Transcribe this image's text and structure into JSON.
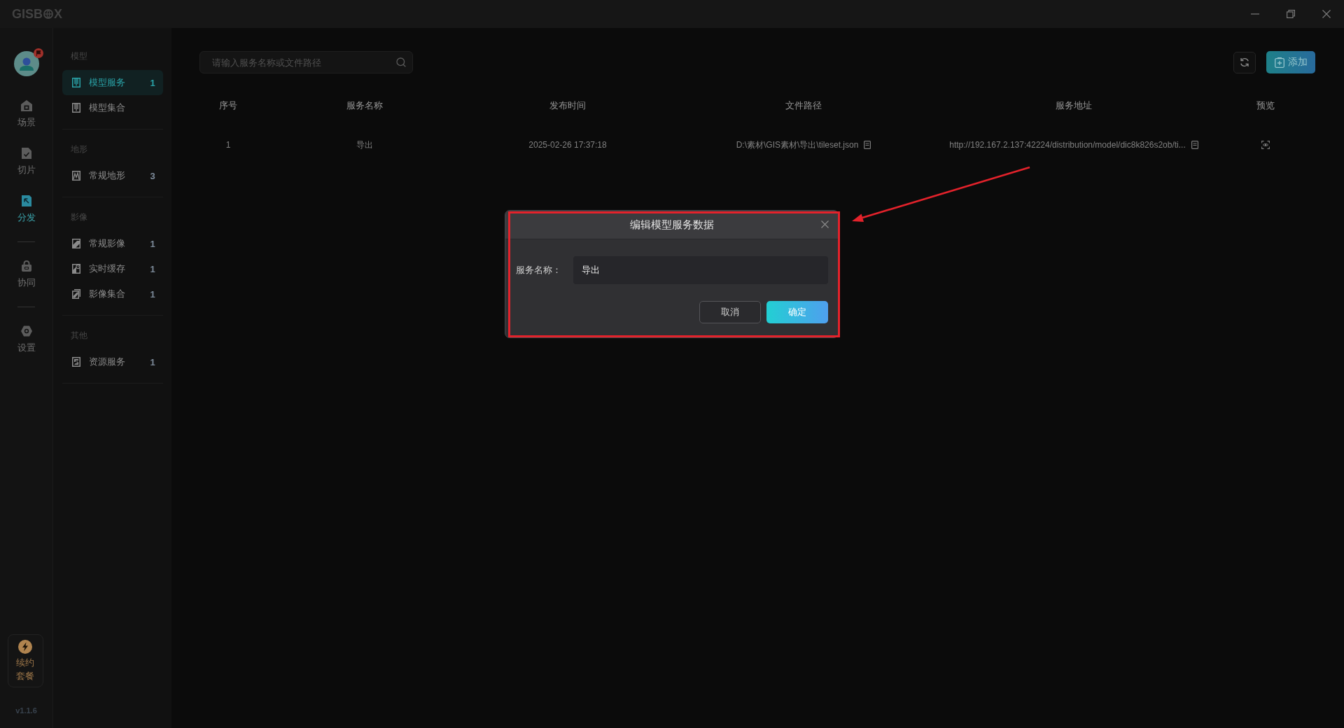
{
  "titlebar": {
    "logo_start": "GISB",
    "logo_end": "X"
  },
  "rail": {
    "groups": [
      {
        "items": [
          {
            "label": "场景",
            "selected": false
          },
          {
            "label": "切片",
            "selected": false
          },
          {
            "label": "分发",
            "selected": true
          }
        ]
      },
      {
        "items": [
          {
            "label": "协同",
            "selected": false
          }
        ]
      },
      {
        "items": [
          {
            "label": "设置",
            "selected": false
          }
        ]
      }
    ],
    "renewal": {
      "label": "续约套餐"
    },
    "version": "v1.1.6"
  },
  "sidebar": {
    "sections": [
      {
        "title": "模型",
        "items": [
          {
            "label": "模型服务",
            "count": "1",
            "selected": true
          },
          {
            "label": "模型集合",
            "selected": false
          }
        ]
      },
      {
        "title": "地形",
        "items": [
          {
            "label": "常规地形",
            "count": "3",
            "selected": false
          }
        ]
      },
      {
        "title": "影像",
        "items": [
          {
            "label": "常规影像",
            "count": "1",
            "selected": false
          },
          {
            "label": "实时缓存",
            "count": "1",
            "selected": false
          },
          {
            "label": "影像集合",
            "count": "1",
            "selected": false
          }
        ]
      },
      {
        "title": "其他",
        "items": [
          {
            "label": "资源服务",
            "count": "1",
            "selected": false
          }
        ]
      }
    ]
  },
  "toolbar": {
    "search": {
      "placeholder": "请输入服务名称或文件路径"
    },
    "add_button": {
      "label": "添加"
    }
  },
  "table": {
    "columns": [
      "序号",
      "服务名称",
      "发布时间",
      "文件路径",
      "服务地址",
      "预览"
    ],
    "rows": [
      {
        "index": "1",
        "name": "导出",
        "published": "2025-02-26 17:37:18",
        "file_path": "D:\\素材\\GIS素材\\导出\\tileset.json",
        "service_url": "http://192.167.2.137:42224/distribution/model/dic8k826s2ob/ti..."
      }
    ]
  },
  "dialog": {
    "title": "编辑模型服务数据",
    "field": {
      "label": "服务名称：",
      "value": "导出"
    },
    "buttons": [
      {
        "label": "取消",
        "kind": "secondary"
      },
      {
        "label": "确定",
        "kind": "primary"
      }
    ]
  }
}
